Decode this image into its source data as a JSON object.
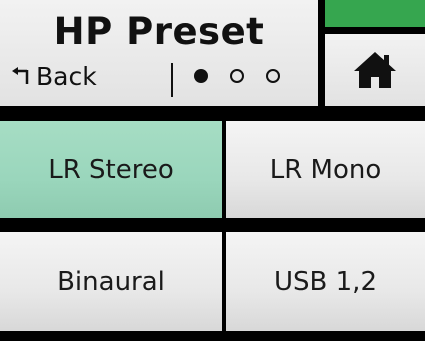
{
  "header": {
    "title": "HP Preset",
    "back_label": "Back",
    "page_indicator": {
      "total": 3,
      "current": 1
    }
  },
  "home": {
    "icon": "home-icon",
    "accent_color": "#36a64f"
  },
  "presets": [
    {
      "label": "LR Stereo",
      "selected": true
    },
    {
      "label": "LR Mono",
      "selected": false
    },
    {
      "label": "Binaural",
      "selected": false
    },
    {
      "label": "USB 1,2",
      "selected": false
    }
  ],
  "colors": {
    "selected": "#9ad6bc",
    "button": "#e8e8e8",
    "background": "#000000"
  }
}
